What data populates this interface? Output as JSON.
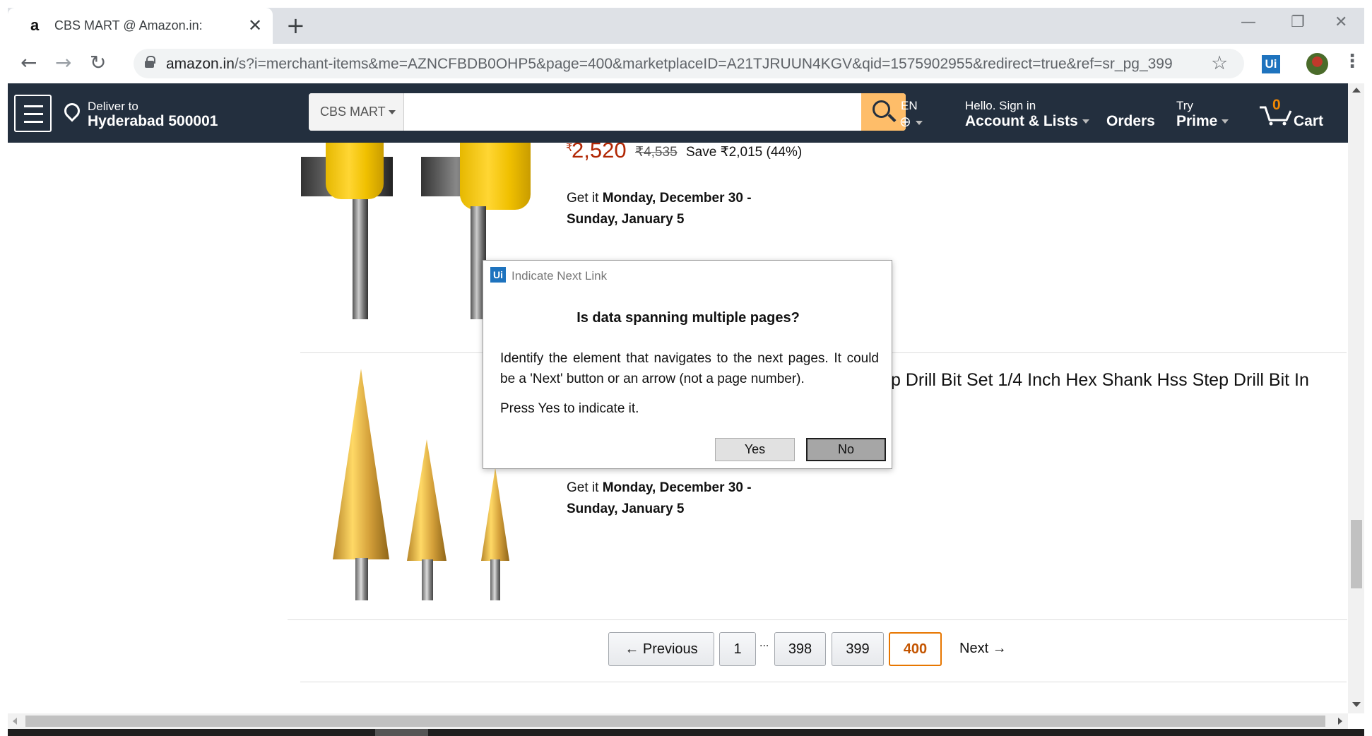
{
  "browser": {
    "tab_title": "CBS MART @ Amazon.in:",
    "tab_favicon": "a",
    "tab_close": "✕",
    "new_tab": "+",
    "url_host": "amazon.in",
    "url_rest": "/s?i=merchant-items&me=AZNCFBDB0OHP5&page=400&marketplaceID=A21TJRUUN4KGV&qid=1575902955&redirect=true&ref=sr_pg_399",
    "ext_label": "Ui",
    "back": "←",
    "forward": "→",
    "reload": "↻",
    "star": "☆",
    "menu": "⋮",
    "minimize": "—",
    "restore": "❐",
    "close": "✕"
  },
  "header": {
    "deliver_line1": "Deliver to",
    "deliver_line2": "Hyderabad 500001",
    "search_scope": "CBS MART",
    "search_placeholder": "",
    "lang": "EN",
    "globe": "⊕",
    "hello": "Hello. Sign in",
    "account": "Account & Lists",
    "orders": "Orders",
    "try": "Try",
    "prime": "Prime",
    "cart_count": "0",
    "cart": "Cart"
  },
  "product1": {
    "price_symbol": "₹",
    "price": "2,520",
    "list_price": "₹4,535",
    "save": "Save ₹2,015 (44%)",
    "delivery_prefix": "Get it ",
    "delivery_dates_l1": "Monday, December 30 -",
    "delivery_dates_l2": "Sunday, January 5"
  },
  "product2": {
    "title_fragment": "p Drill Bit Set 1/4 Inch Hex Shank Hss Step Drill Bit In",
    "delivery_prefix": "Get it ",
    "delivery_dates_l1": "Monday, December 30 -",
    "delivery_dates_l2": "Sunday, January 5"
  },
  "pagination": {
    "previous": "← Previous",
    "pages": [
      "1",
      "398",
      "399",
      "400"
    ],
    "current": "400",
    "dots": "...",
    "next": "Next →"
  },
  "dialog": {
    "app_badge": "Ui",
    "title": "Indicate Next Link",
    "question": "Is data spanning multiple pages?",
    "body": "Identify the element that navigates to the next pages. It could be a 'Next' button or an arrow (not a page number).",
    "press": "Press Yes to indicate it.",
    "yes": "Yes",
    "no": "No"
  },
  "colors": {
    "amazon_header": "#232f3e",
    "search_button": "#febd69",
    "price": "#b12704",
    "cart_count": "#f08804",
    "current_page_border": "#e77600",
    "uipath_blue": "#1e73be"
  }
}
